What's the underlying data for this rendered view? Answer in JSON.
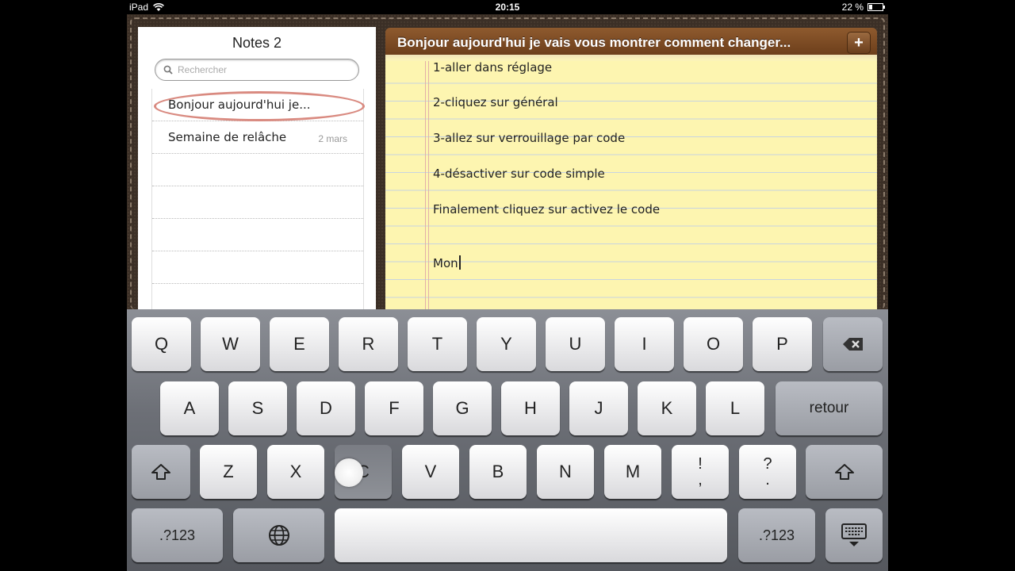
{
  "status_bar": {
    "device": "iPad",
    "time": "20:15",
    "battery_text": "22 %",
    "battery_level": 0.22
  },
  "notes_list": {
    "title": "Notes 2",
    "search_placeholder": "Rechercher",
    "items": [
      {
        "title": "Bonjour aujourd'hui je...",
        "date": "",
        "selected": true
      },
      {
        "title": "Semaine de relâche",
        "date": "2 mars",
        "selected": false
      }
    ]
  },
  "note": {
    "title": "Bonjour aujourd'hui je vais vous montrer comment changer...",
    "add_label": "+",
    "lines": [
      "1-aller dans réglage",
      "2-cliquez sur général",
      "3-allez sur verrouillage par code",
      "4-désactiver sur code simple",
      "Finalement  cliquez sur activez le code",
      "Mon"
    ]
  },
  "keyboard": {
    "row1": [
      "Q",
      "W",
      "E",
      "R",
      "T",
      "Y",
      "U",
      "I",
      "O",
      "P"
    ],
    "row2": [
      "A",
      "S",
      "D",
      "F",
      "G",
      "H",
      "J",
      "K",
      "L"
    ],
    "row3": [
      "Z",
      "X",
      "C",
      "V",
      "B",
      "N",
      "M"
    ],
    "punct1": [
      "!",
      ","
    ],
    "punct2": [
      "?",
      "."
    ],
    "return_label": "retour",
    "numbers_label": ".?123",
    "pressed_key": "C",
    "icons": {
      "backspace": "backspace-icon",
      "shift": "shift-icon",
      "globe": "globe-icon",
      "hide": "hide-keyboard-icon"
    }
  },
  "colors": {
    "paper": "#fdf5b0",
    "header": "#7a4a24",
    "leather": "#3b2f26",
    "selection_circle": "#d98a80"
  }
}
